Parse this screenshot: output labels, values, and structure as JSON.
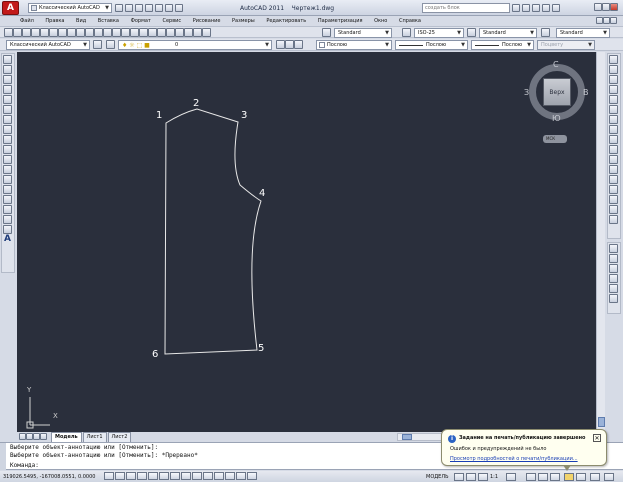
{
  "titlebar": {
    "workspace": "Классический AutoCAD",
    "title": "AutoCAD 2011    Чертеж1.dwg",
    "search_placeholder": "создать блок"
  },
  "menu": [
    "Файл",
    "Правка",
    "Вид",
    "Вставка",
    "Формат",
    "Сервис",
    "Рисование",
    "Размеры",
    "Редактировать",
    "Параметризация",
    "Окно",
    "Справка"
  ],
  "toolbar2": {
    "text_style": "Standard",
    "dim_style": "ISO-25",
    "table_style": "Standard",
    "mleader_style": "Standard"
  },
  "toolbar3": {
    "workspace": "Классический AutoCAD",
    "layer": "0",
    "color": "Послою",
    "linetype": "Послою",
    "lineweight": "Послою",
    "plotstyle": "Поцвету"
  },
  "viewcube": {
    "face": "Верх",
    "north": "С",
    "south": "Ю",
    "east": "В",
    "west": "З",
    "ucs": "МСК"
  },
  "drawing": {
    "points": [
      {
        "label": "1"
      },
      {
        "label": "2"
      },
      {
        "label": "3"
      },
      {
        "label": "4"
      },
      {
        "label": "5"
      },
      {
        "label": "6"
      }
    ],
    "ucs_x": "X",
    "ucs_y": "Y"
  },
  "layout_tabs": [
    "Модель",
    "Лист1",
    "Лист2"
  ],
  "command": {
    "line1": "Выберите объект-аннотацию или [Отменить]:",
    "line2": "Выберите объект-аннотацию или [Отменить]: *Прервано*",
    "prompt": "Команда:"
  },
  "status": {
    "coords": "319026.5495, -167008.0551, 0.0000",
    "model": "МОДЕЛЬ",
    "scale": "1:1"
  },
  "notification": {
    "title": "Задание на печать/публикацию завершено",
    "body": "Ошибок и предупреждений не было",
    "link": "Просмотр подробностей о печати/публикации..."
  },
  "colors": {
    "canvas": "#2a2f3c",
    "accent": "#c21a1a"
  }
}
